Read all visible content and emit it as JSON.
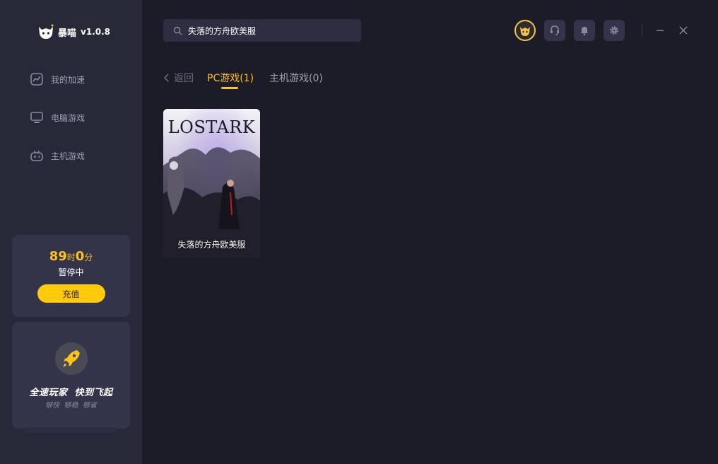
{
  "app": {
    "name": "暴喵",
    "version": "v1.0.8"
  },
  "sidebar": {
    "items": [
      {
        "label": "我的加速",
        "icon": "speed-chart-icon"
      },
      {
        "label": "电脑游戏",
        "icon": "monitor-icon"
      },
      {
        "label": "主机游戏",
        "icon": "gamepad-icon"
      }
    ]
  },
  "time_card": {
    "hours": "89",
    "hours_unit": "时",
    "minutes": "0",
    "minutes_unit": "分",
    "status": "暂停中",
    "recharge_label": "充值"
  },
  "promo": {
    "title": "全速玩家  快到飞起",
    "subtitle": "够快  够稳  够省",
    "icon": "rocket-icon"
  },
  "search": {
    "value": "失落的方舟欧美服",
    "icon": "search-icon"
  },
  "header_icons": [
    "avatar-icon",
    "headset-icon",
    "bell-icon",
    "gear-icon",
    "minimize-icon",
    "close-icon"
  ],
  "tabs": {
    "back_label": "返回",
    "pc_label": "PC游戏(1)",
    "console_label": "主机游戏(0)"
  },
  "games": [
    {
      "title": "失落的方舟欧美服",
      "art_text": "LOSTARK"
    }
  ],
  "colors": {
    "accent": "#ffc21a",
    "background": "#1c1c28",
    "sidebar": "#272838",
    "card": "#33344a"
  }
}
